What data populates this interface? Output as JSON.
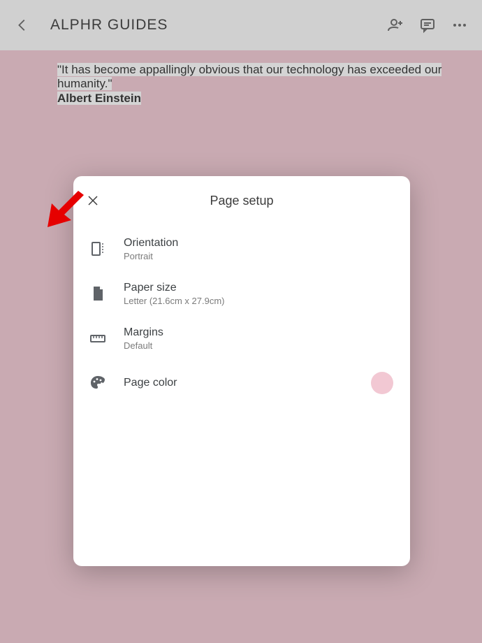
{
  "topbar": {
    "title": "ALPHR GUIDES"
  },
  "document": {
    "quote": "\"It has become appallingly obvious that our technology has exceeded our humanity.\"",
    "author": "Albert Einstein"
  },
  "dialog": {
    "title": "Page setup",
    "orientation": {
      "label": "Orientation",
      "value": "Portrait"
    },
    "paper": {
      "label": "Paper size",
      "value": "Letter (21.6cm x 27.9cm)"
    },
    "margins": {
      "label": "Margins",
      "value": "Default"
    },
    "pagecolor": {
      "label": "Page color",
      "swatch": "#f2c8d3"
    }
  }
}
